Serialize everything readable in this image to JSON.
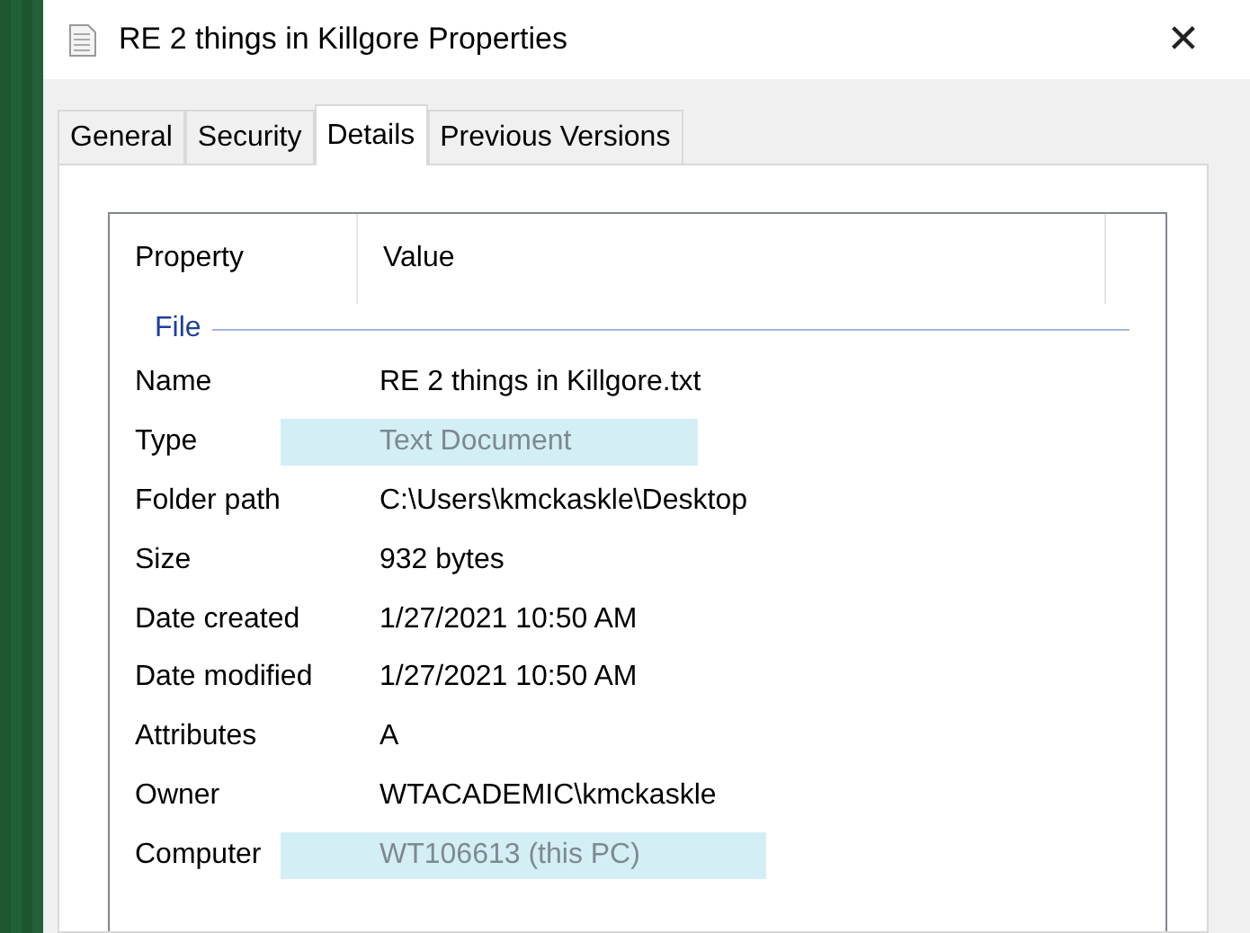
{
  "window": {
    "title": "RE 2 things in Killgore Properties",
    "close": "✕"
  },
  "tabs": [
    {
      "label": "General",
      "selected": false
    },
    {
      "label": "Security",
      "selected": false
    },
    {
      "label": "Details",
      "selected": true
    },
    {
      "label": "Previous Versions",
      "selected": false
    }
  ],
  "columns": [
    "Property",
    "Value"
  ],
  "group": "File",
  "rows": [
    {
      "property": "Name",
      "value": "RE 2 things in Killgore.txt",
      "highlighted": false
    },
    {
      "property": "Type",
      "value": "Text Document",
      "highlighted": true
    },
    {
      "property": "Folder path",
      "value": "C:\\Users\\kmckaskle\\Desktop",
      "highlighted": false
    },
    {
      "property": "Size",
      "value": "932 bytes",
      "highlighted": false
    },
    {
      "property": "Date created",
      "value": "1/27/2021 10:50 AM",
      "highlighted": false
    },
    {
      "property": "Date modified",
      "value": "1/27/2021 10:50 AM",
      "highlighted": false
    },
    {
      "property": "Attributes",
      "value": "A",
      "highlighted": false
    },
    {
      "property": "Owner",
      "value": "WTACADEMIC\\kmckaskle",
      "highlighted": false
    },
    {
      "property": "Computer",
      "value": "WT106613 (this PC)",
      "highlighted": true
    }
  ]
}
